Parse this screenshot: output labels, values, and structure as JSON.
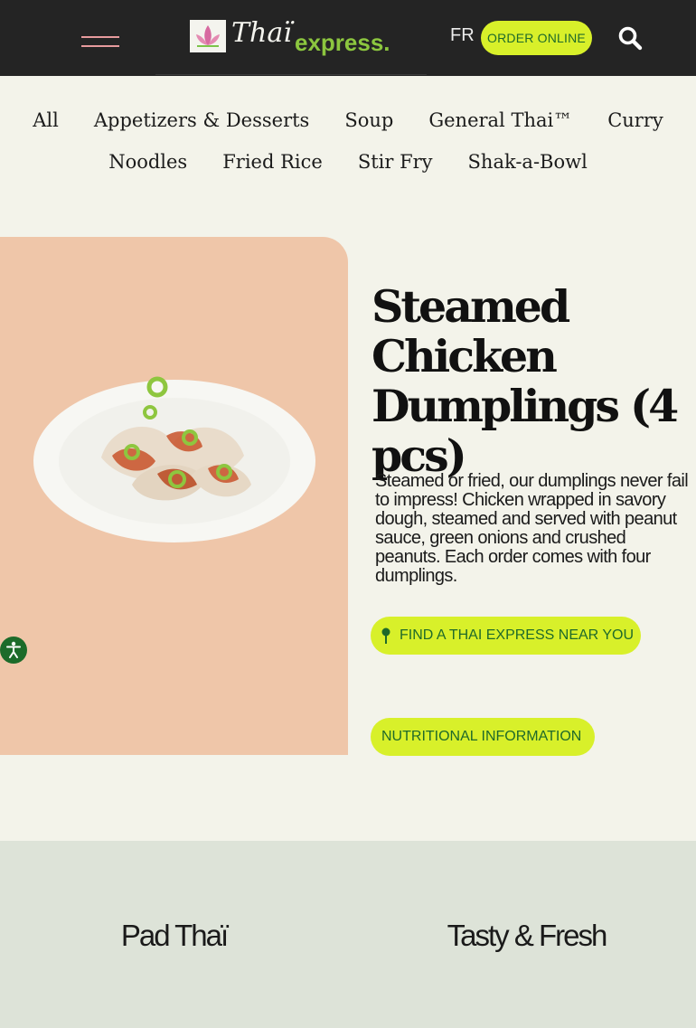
{
  "header": {
    "brand": "Thaï express",
    "lang_label": "FR",
    "order_label": "ORDER ONLINE"
  },
  "categories": {
    "row1": [
      "All",
      "Appetizers & Desserts",
      "Soup",
      "General Thai™",
      "Curry"
    ],
    "row2": [
      "Noodles",
      "Fried Rice",
      "Stir Fry",
      "Shak-a-Bowl"
    ]
  },
  "product": {
    "title": "Steamed Chicken Dumplings (4 pcs)",
    "description": "Steamed or fried, our dumplings never fail to impress! Chicken wrapped in savory dough, steamed and served with peanut sauce, green onions and crushed peanuts. Each order comes with four dumplings.",
    "find_label": "FIND A THAI EXPRESS NEAR YOU",
    "nutrition_label": "NUTRITIONAL INFORMATION"
  },
  "related": {
    "left_title": "Pad Thaï",
    "right_title": "Tasty & Fresh"
  },
  "colors": {
    "header_bg": "#242424",
    "accent_lime": "#d8f02a",
    "brand_green": "#1f6a2a",
    "card_peach": "#efc6a9",
    "page_bg": "#f3f3ea",
    "band_bg": "#dde3d8"
  },
  "icons": [
    "menu-icon",
    "lotus-logo-icon",
    "search-icon",
    "map-pin-icon",
    "accessibility-icon"
  ]
}
